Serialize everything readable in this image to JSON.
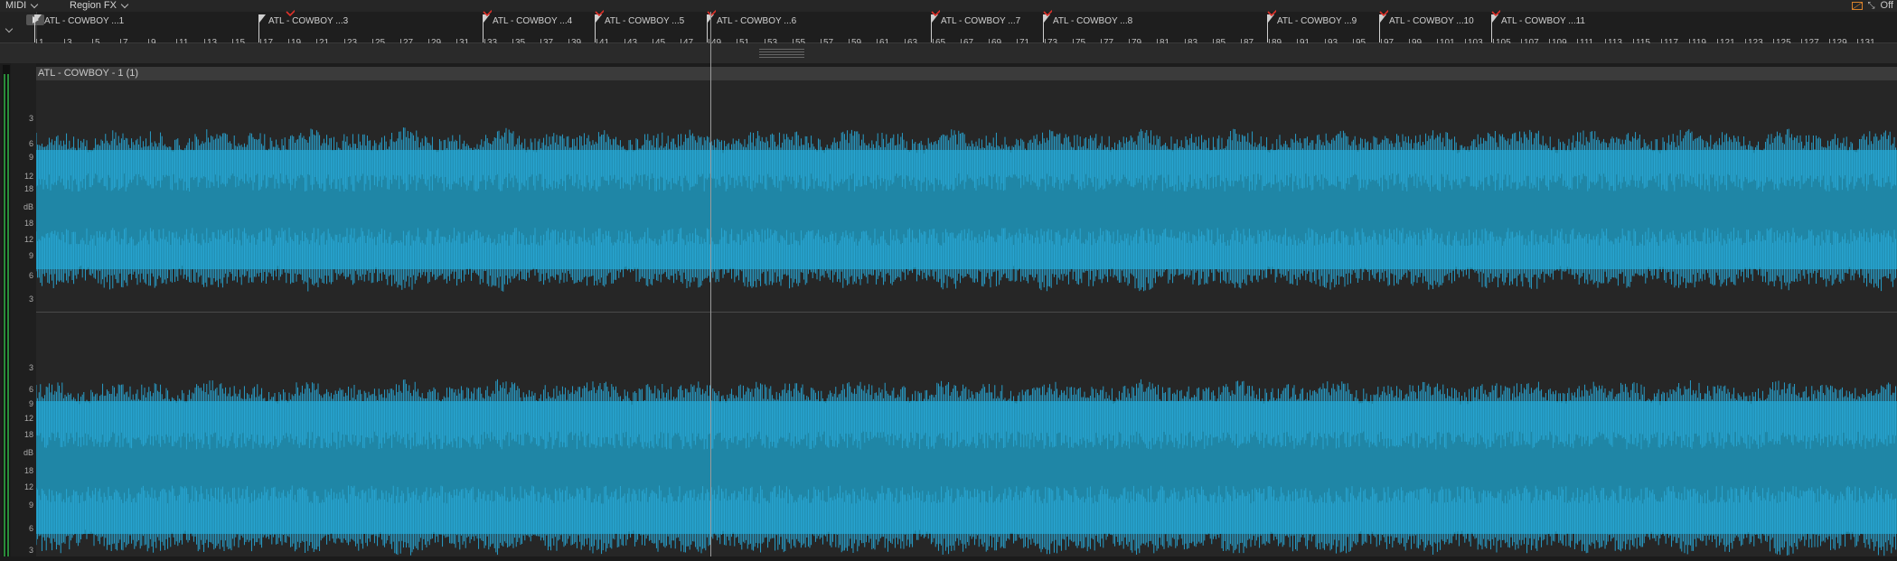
{
  "toolbar": {
    "midi_label": "MIDI",
    "region_fx_label": "Region FX",
    "snap_label": "Off"
  },
  "timeline": {
    "markers": [
      {
        "label": "ATL - COWBOY ...1",
        "bar": 1
      },
      {
        "label": "ATL - COWBOY ...3",
        "bar": 17
      },
      {
        "label": "ATL - COWBOY ...4",
        "bar": 33
      },
      {
        "label": "ATL - COWBOY ...5",
        "bar": 41
      },
      {
        "label": "ATL - COWBOY ...6",
        "bar": 49
      },
      {
        "label": "ATL - COWBOY ...7",
        "bar": 65
      },
      {
        "label": "ATL - COWBOY ...8",
        "bar": 73
      },
      {
        "label": "ATL - COWBOY ...9",
        "bar": 89
      },
      {
        "label": "ATL - COWBOY ...10",
        "bar": 97
      },
      {
        "label": "ATL - COWBOY ...11",
        "bar": 105
      }
    ],
    "bar_numbers": [
      "1",
      "3",
      "5",
      "7",
      "9",
      "11",
      "13",
      "15",
      "17",
      "19",
      "21",
      "23",
      "25",
      "27",
      "29",
      "31",
      "33",
      "35",
      "37",
      "39",
      "41",
      "43",
      "45",
      "47",
      "49",
      "51",
      "53",
      "55",
      "57",
      "59",
      "61",
      "63",
      "65",
      "67",
      "69",
      "71",
      "73",
      "75",
      "77",
      "79",
      "81",
      "83",
      "85",
      "87",
      "89",
      "91",
      "93",
      "95",
      "97",
      "99",
      "101",
      "103",
      "105",
      "107",
      "109",
      "111",
      "113",
      "115",
      "117",
      "119",
      "121",
      "123",
      "125",
      "127",
      "129",
      "131"
    ]
  },
  "editor": {
    "region_title": "ATL - COWBOY - 1 (1)",
    "db_scale": [
      "3",
      "6",
      "9",
      "12",
      "18",
      "dB",
      "18",
      "12",
      "9",
      "6",
      "3"
    ],
    "waveform_color": "#29a9d8",
    "waveform_fill": "#1f86a6"
  },
  "colors": {
    "annotation_red": "#e0322a",
    "marker": "#cfcfcf"
  }
}
